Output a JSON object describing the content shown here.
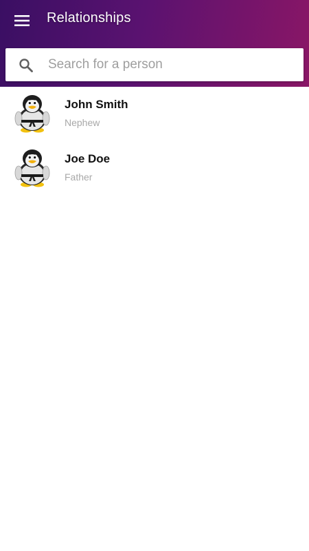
{
  "header": {
    "title": "Relationships",
    "menu_icon": "hamburger-menu-icon",
    "gradient_start": "#3a0f63",
    "gradient_end": "#8a1666"
  },
  "search": {
    "placeholder": "Search for a person",
    "value": "",
    "icon": "search-icon"
  },
  "people": [
    {
      "name": "John Smith",
      "relation": "Nephew",
      "avatar": "penguin-karate-avatar"
    },
    {
      "name": "Joe Doe",
      "relation": "Father",
      "avatar": "penguin-karate-avatar"
    }
  ]
}
